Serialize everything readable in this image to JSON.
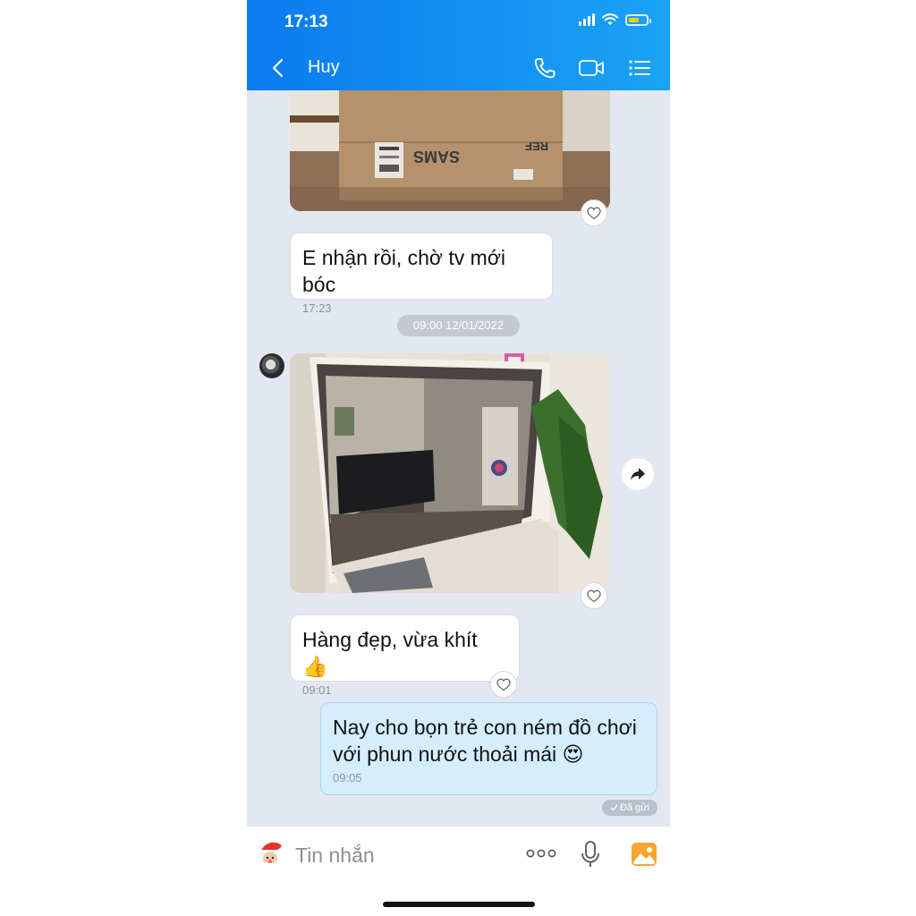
{
  "status_bar": {
    "time": "17:13"
  },
  "header": {
    "contact_name": "Huy"
  },
  "messages": [
    {
      "id": "m1",
      "type": "text",
      "sender": "other",
      "text": "E nhận rồi, chờ tv mới bóc",
      "time": "17:23"
    },
    {
      "id": "m2",
      "type": "text",
      "sender": "other",
      "text": "Hàng đẹp, vừa khít 👍",
      "time": "09:01"
    },
    {
      "id": "m3",
      "type": "text",
      "sender": "me",
      "line1": "Nay cho bọn trẻ con ném đồ chơi",
      "line2": "với phun nước thoải mái 😍",
      "time": "09:05"
    }
  ],
  "date_divider": "09:00 12/01/2022",
  "sent_status": "Đã gửi",
  "input": {
    "placeholder": "Tin nhắn"
  },
  "colors": {
    "header_start": "#0b7bf0",
    "header_end": "#1aa3f5",
    "chat_bg": "#e2e7f1",
    "my_bubble": "#d5eefe"
  },
  "icons": [
    "back-icon",
    "phone-icon",
    "video-call-icon",
    "menu-list-icon",
    "heart-icon",
    "share-icon",
    "santa-sticker-icon",
    "more-icon",
    "microphone-icon",
    "gallery-icon"
  ]
}
